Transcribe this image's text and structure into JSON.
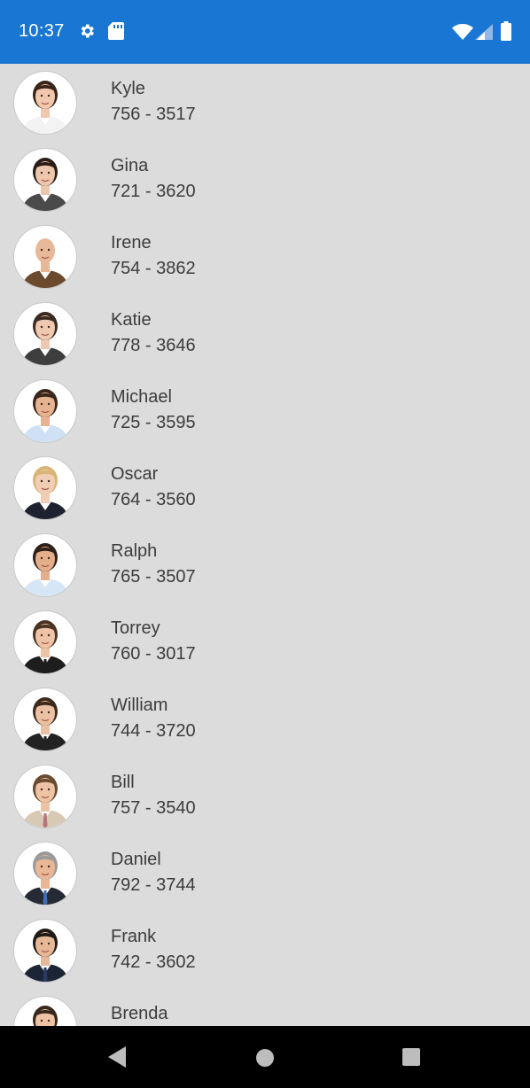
{
  "status_bar": {
    "time": "10:37",
    "background": "#1976d2",
    "icons_left": [
      "gear-icon",
      "sd-card-icon"
    ],
    "icons_right": [
      "wifi-icon",
      "signal-icon",
      "battery-icon"
    ]
  },
  "contacts": [
    {
      "name": "Kyle",
      "phone": "756 - 3517",
      "avatar": {
        "hair": "#3b2418",
        "skin": "#f1c8ae",
        "shirt": "#f3f3f3",
        "tie": ""
      }
    },
    {
      "name": "Gina",
      "phone": "721 - 3620",
      "avatar": {
        "hair": "#2b1d16",
        "skin": "#edc6ad",
        "shirt": "#4a4a4a",
        "tie": ""
      }
    },
    {
      "name": "Irene",
      "phone": "754 - 3862",
      "avatar": {
        "hair": "",
        "skin": "#e8b999",
        "shirt": "#6b4a2e",
        "tie": ""
      }
    },
    {
      "name": "Katie",
      "phone": "778 - 3646",
      "avatar": {
        "hair": "#3a2a22",
        "skin": "#eec8b0",
        "shirt": "#3e3e3e",
        "tie": ""
      }
    },
    {
      "name": "Michael",
      "phone": "725 - 3595",
      "avatar": {
        "hair": "#3a271b",
        "skin": "#e6b391",
        "shirt": "#cfe2f5",
        "tie": ""
      }
    },
    {
      "name": "Oscar",
      "phone": "764 - 3560",
      "avatar": {
        "hair": "#d8b475",
        "skin": "#f1cdb5",
        "shirt": "#1e2230",
        "tie": ""
      }
    },
    {
      "name": "Ralph",
      "phone": "765 - 3507",
      "avatar": {
        "hair": "#2f2018",
        "skin": "#e4ae8a",
        "shirt": "#d6e6f6",
        "tie": ""
      }
    },
    {
      "name": "Torrey",
      "phone": "760 - 3017",
      "avatar": {
        "hair": "#4a3323",
        "skin": "#eec3a6",
        "shirt": "#1d1d1d",
        "tie": "#1d1d1d"
      }
    },
    {
      "name": "William",
      "phone": "744 - 3720",
      "avatar": {
        "hair": "#3d2a1d",
        "skin": "#ecc1a3",
        "shirt": "#222222",
        "tie": "#222222"
      }
    },
    {
      "name": "Bill",
      "phone": "757 - 3540",
      "avatar": {
        "hair": "#6a4a30",
        "skin": "#edc3a3",
        "shirt": "#d8c9b4",
        "tie": "#b8727a"
      }
    },
    {
      "name": "Daniel",
      "phone": "792 - 3744",
      "avatar": {
        "hair": "#9a9a9a",
        "skin": "#e9b796",
        "shirt": "#262a35",
        "tie": "#3f6fb5"
      }
    },
    {
      "name": "Frank",
      "phone": "742 - 3602",
      "avatar": {
        "hair": "#1f1a17",
        "skin": "#e6b896",
        "shirt": "#1c2535",
        "tie": "#2a3a66"
      }
    },
    {
      "name": "Brenda",
      "phone": "",
      "avatar": {
        "hair": "#3a271b",
        "skin": "#eec3a6",
        "shirt": "#dddddd",
        "tie": ""
      }
    }
  ],
  "nav_bar": {
    "buttons": [
      "back-icon",
      "home-icon",
      "recents-icon"
    ],
    "background": "#000000"
  }
}
